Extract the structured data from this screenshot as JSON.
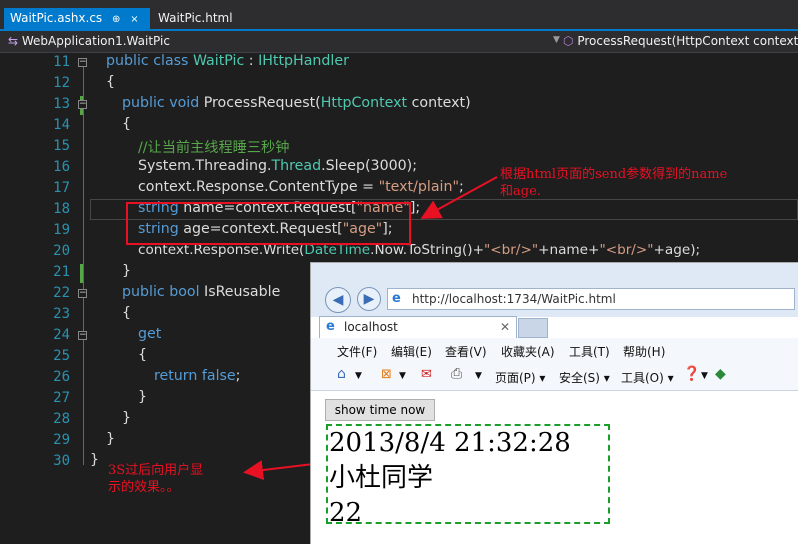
{
  "tabs": [
    {
      "label": "WaitPic.ashx.cs",
      "pin": "⊕",
      "close": "×"
    },
    {
      "label": "WaitPic.html"
    }
  ],
  "navbar": {
    "left": "WebApplication1.WaitPic",
    "right": "ProcessRequest(HttpContext context)"
  },
  "line_numbers": [
    "11",
    "12",
    "13",
    "14",
    "15",
    "16",
    "17",
    "18",
    "19",
    "20",
    "21",
    "22",
    "23",
    "24",
    "25",
    "26",
    "27",
    "28",
    "29",
    "30"
  ],
  "code": {
    "l11": [
      "public class ",
      "WaitPic",
      " : ",
      "IHttpHandler"
    ],
    "l12": "{",
    "l13": [
      "public void ",
      "ProcessRequest(",
      "HttpContext",
      " context)"
    ],
    "l14": "{",
    "l15": "//让当前主线程睡三秒钟",
    "l16": [
      "System.Threading.",
      "Thread",
      ".Sleep(3000);"
    ],
    "l17": [
      "context.Response.ContentType = ",
      "\"text/plain\"",
      ";"
    ],
    "l18": [
      "string",
      " name=context.Request[",
      "\"name\"",
      "];"
    ],
    "l19": [
      "string",
      " age=context.Request[",
      "\"age\"",
      "];"
    ],
    "l20": [
      "context.Response.Write(",
      "DateTime",
      ".Now.ToString()+",
      "\"<br/>\"",
      "+name+",
      "\"<br/>\"",
      "+age);"
    ],
    "l21": "}",
    "l22": [
      "public bool ",
      "IsReusable"
    ],
    "l23": "{",
    "l24": "get",
    "l25": "{",
    "l26": [
      "return false",
      ";"
    ],
    "l27": "}",
    "l28": "}",
    "l29": "}",
    "l30": "}"
  },
  "annotations": {
    "top_line1": "根据html页面的send参数得到的name",
    "top_line2": "和age.",
    "bottom_line1": "3S过后向用户显",
    "bottom_line2": "示的效果。。"
  },
  "browser": {
    "url": "http://localhost:1734/WaitPic.html",
    "tab_title": "localhost",
    "menu": [
      "文件(F)",
      "编辑(E)",
      "查看(V)",
      "收藏夹(A)",
      "工具(T)",
      "帮助(H)"
    ],
    "commands": [
      "页面(P) ▾",
      "安全(S) ▾",
      "工具(O) ▾"
    ],
    "button_label": "show time now",
    "result_lines": [
      "2013/8/4 21:32:28",
      "小杜同学",
      "22"
    ]
  },
  "colors": {
    "accent": "#007acc",
    "annotation": "#e81123",
    "dashed_border": "#1a9e2a"
  }
}
